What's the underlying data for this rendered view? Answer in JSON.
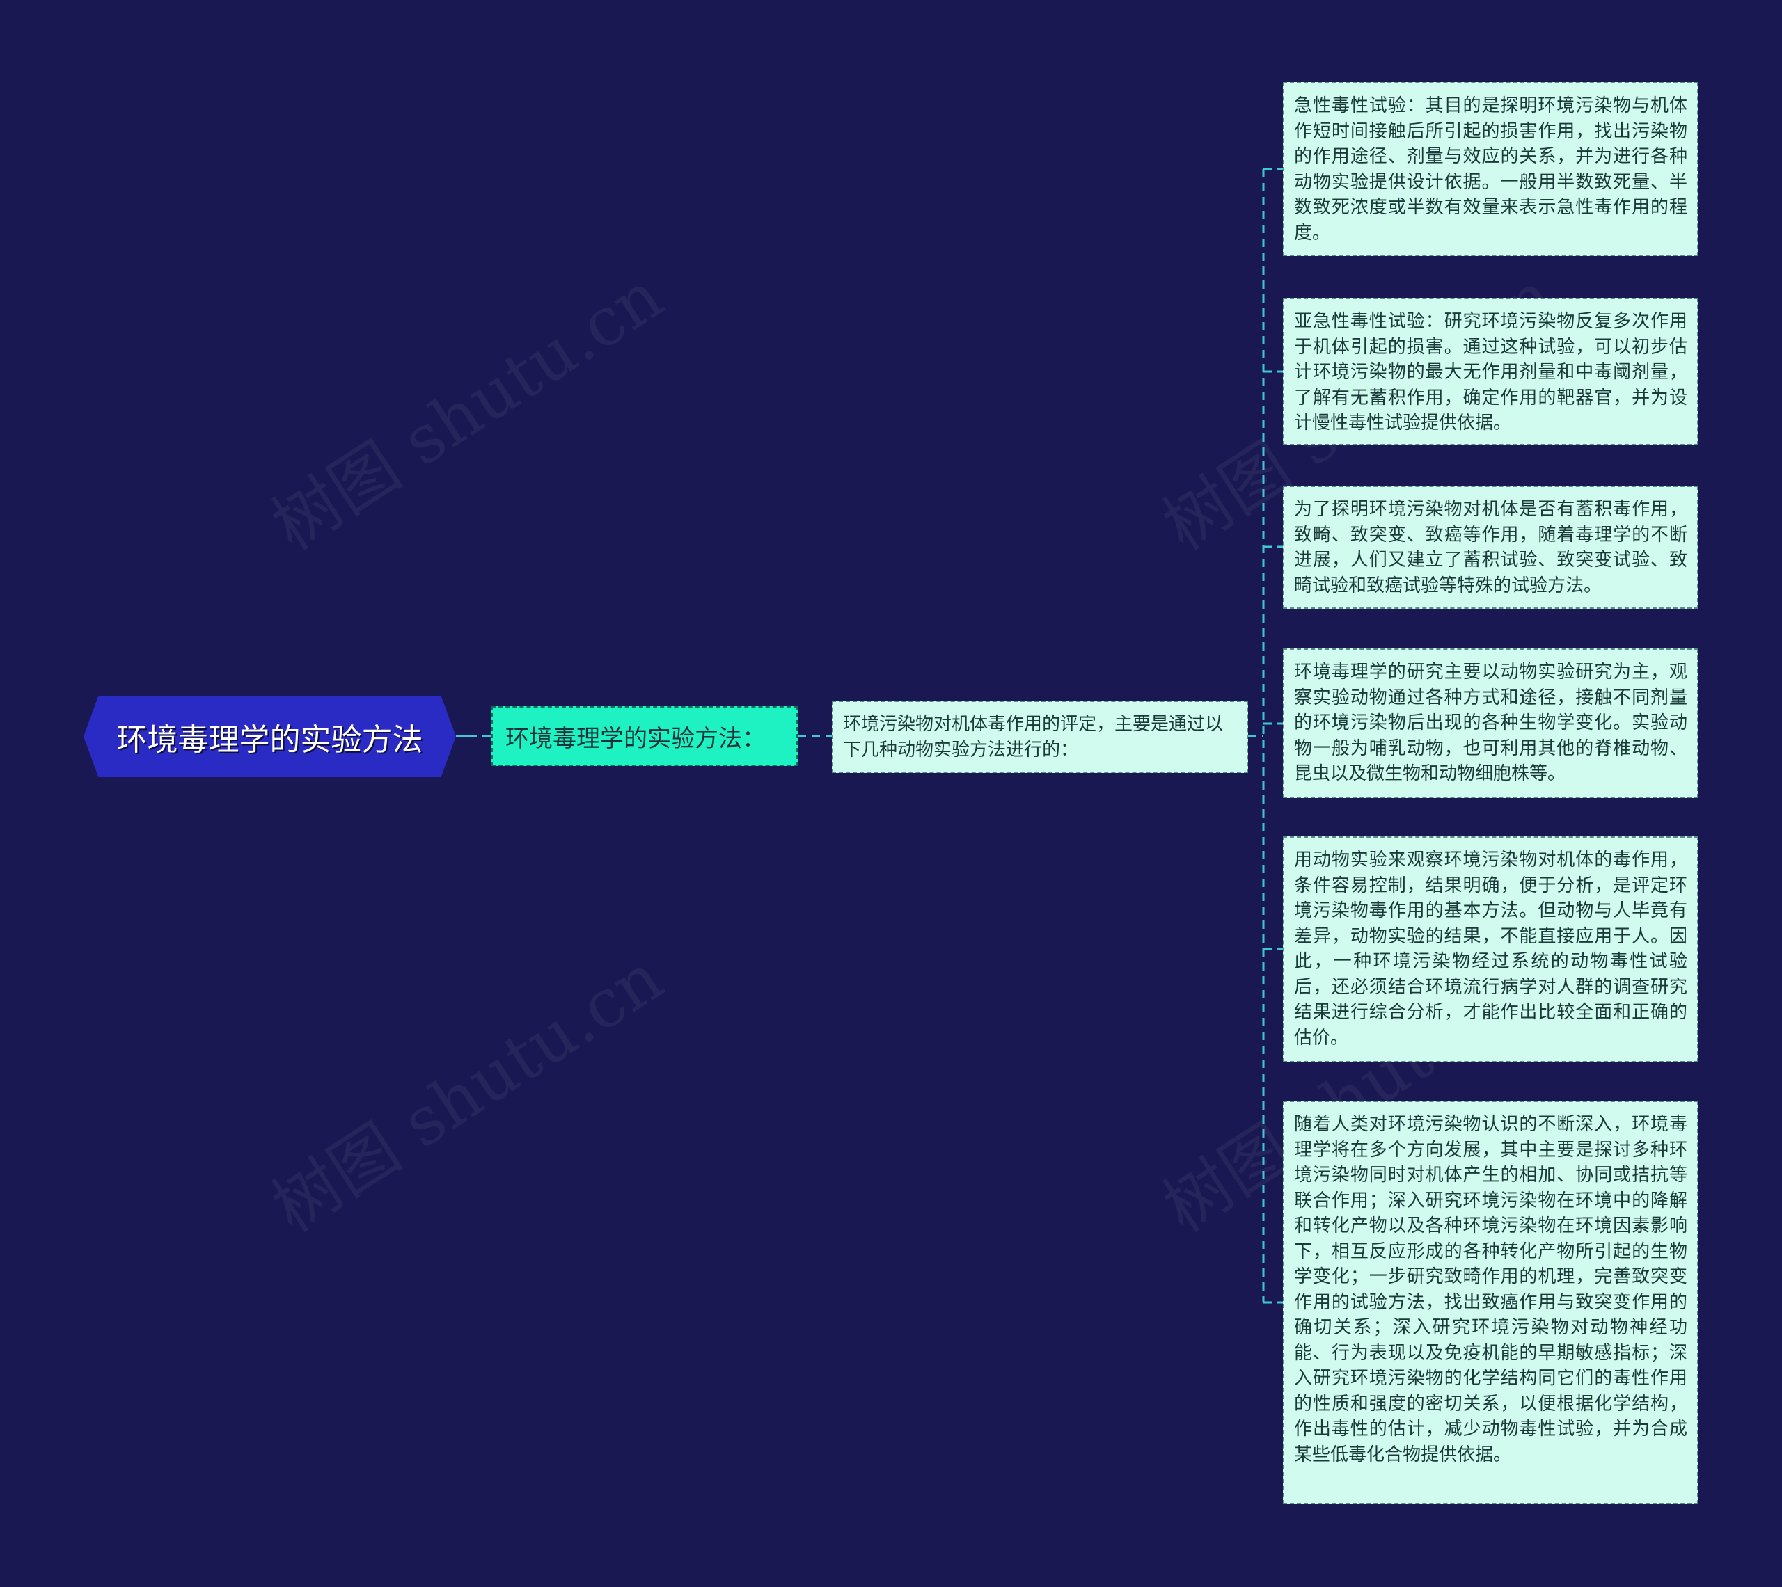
{
  "watermark": {
    "text": "树图 shutu.cn"
  },
  "colors": {
    "background": "#191852",
    "root_fill": "#2a2ac4",
    "level1_fill": "#1ef2c2",
    "leaf_fill": "#d2fbef",
    "connector": "#3ec8d6"
  },
  "mindmap": {
    "root": {
      "label": "环境毒理学的实验方法"
    },
    "level1": {
      "label": "环境毒理学的实验方法："
    },
    "level2": {
      "label": "环境污染物对机体毒作用的评定，主要是通过以下几种动物实验方法进行的："
    },
    "leaves": [
      {
        "label": "急性毒性试验：其目的是探明环境污染物与机体作短时间接触后所引起的损害作用，找出污染物的作用途径、剂量与效应的关系，并为进行各种动物实验提供设计依据。一般用半数致死量、半数致死浓度或半数有效量来表示急性毒作用的程度。"
      },
      {
        "label": "亚急性毒性试验：研究环境污染物反复多次作用于机体引起的损害。通过这种试验，可以初步估计环境污染物的最大无作用剂量和中毒阈剂量，了解有无蓄积作用，确定作用的靶器官，并为设计慢性毒性试验提供依据。"
      },
      {
        "label": "为了探明环境污染物对机体是否有蓄积毒作用，致畸、致突变、致癌等作用，随着毒理学的不断进展，人们又建立了蓄积试验、致突变试验、致畸试验和致癌试验等特殊的试验方法。"
      },
      {
        "label": "环境毒理学的研究主要以动物实验研究为主，观察实验动物通过各种方式和途径，接触不同剂量的环境污染物后出现的各种生物学变化。实验动物一般为哺乳动物，也可利用其他的脊椎动物、昆虫以及微生物和动物细胞株等。"
      },
      {
        "label": "用动物实验来观察环境污染物对机体的毒作用，条件容易控制，结果明确，便于分析，是评定环境污染物毒作用的基本方法。但动物与人毕竟有差异，动物实验的结果，不能直接应用于人。因此，一种环境污染物经过系统的动物毒性试验后，还必须结合环境流行病学对人群的调查研究结果进行综合分析，才能作出比较全面和正确的估价。"
      },
      {
        "label": "随着人类对环境污染物认识的不断深入，环境毒理学将在多个方向发展，其中主要是探讨多种环境污染物同时对机体产生的相加、协同或拮抗等联合作用；深入研究环境污染物在环境中的降解和转化产物以及各种环境污染物在环境因素影响下，相互反应形成的各种转化产物所引起的生物学变化；一步研究致畸作用的机理，完善致突变作用的试验方法，找出致癌作用与致突变作用的确切关系；深入研究环境污染物对动物神经功能、行为表现以及免疫机能的早期敏感指标；深入研究环境污染物的化学结构同它们的毒性作用的性质和强度的密切关系，以便根据化学结构，作出毒性的估计，减少动物毒性试验，并为合成某些低毒化合物提供依据。"
      }
    ]
  }
}
